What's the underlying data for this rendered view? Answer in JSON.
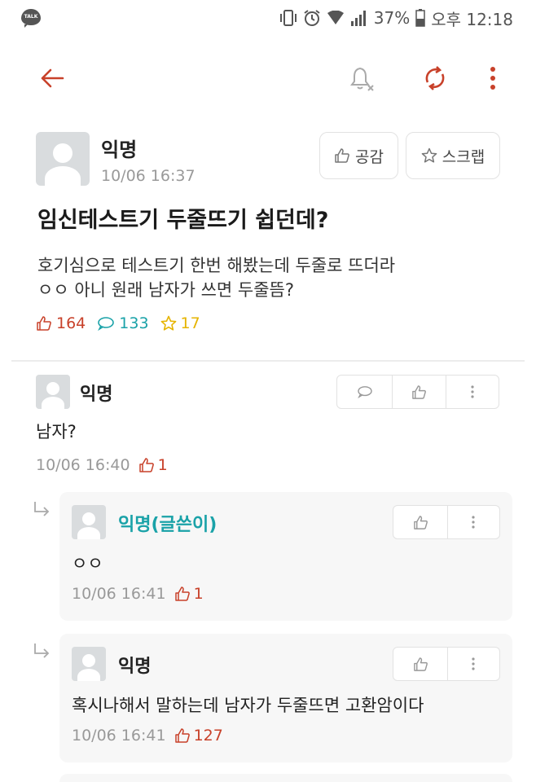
{
  "status_bar": {
    "app_badge": "TALK",
    "battery": "37%",
    "time": "오후 12:18"
  },
  "top_bar": {
    "back_icon": "arrow-left-icon",
    "notify_icon": "bell-off-icon",
    "refresh_icon": "refresh-icon",
    "more_icon": "more-vertical-icon",
    "accent": "#c8412a"
  },
  "post": {
    "author": "익명",
    "date": "10/06 16:37",
    "like_button": "공감",
    "scrap_button": "스크랩",
    "title": "임신테스트기 두줄뜨기 쉽던데?",
    "body_lines": [
      "호기심으로 테스트기 한번 해봤는데 두줄로 뜨더라",
      "ㅇㅇ 아니 원래 남자가 쓰면 두줄뜸?"
    ],
    "likes": "164",
    "comments": "133",
    "scraps": "17"
  },
  "comments": [
    {
      "author": "익명",
      "text": "남자?",
      "date": "10/06 16:40",
      "likes": "1"
    }
  ],
  "replies": [
    {
      "author": "익명(글쓴이)",
      "text": "ㅇㅇ",
      "date": "10/06 16:41",
      "likes": "1",
      "author_color": "#1aa2a8"
    },
    {
      "author": "익명",
      "text": "혹시나해서 말하는데 남자가 두줄뜨면 고환암이다",
      "date": "10/06 16:41",
      "likes": "127"
    }
  ]
}
